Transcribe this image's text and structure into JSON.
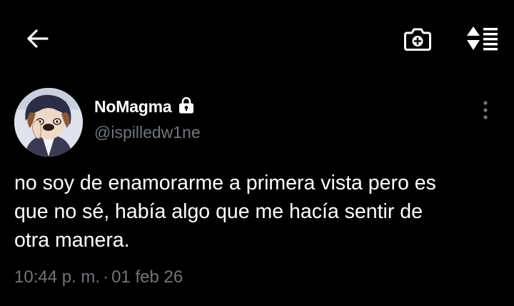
{
  "header": {
    "back_icon": "arrow-left-icon",
    "camera_icon": "camera-plus-icon",
    "sort_icon": "sort-replies-icon"
  },
  "author": {
    "display_name": "NoMagma",
    "protected_icon": "lock-icon",
    "handle": "@ispilledw1ne",
    "more_icon": "more-vertical-icon"
  },
  "tweet": {
    "text": "no soy de enamorarme a primera vista pero es\nque no sé, había algo que me hacía sentir de\notra manera.",
    "time": "10:44 p. m.",
    "separator": "·",
    "date": "01 feb 26"
  },
  "colors": {
    "background": "#000000",
    "primary_text": "#ffffff",
    "secondary_text": "#71767b"
  }
}
